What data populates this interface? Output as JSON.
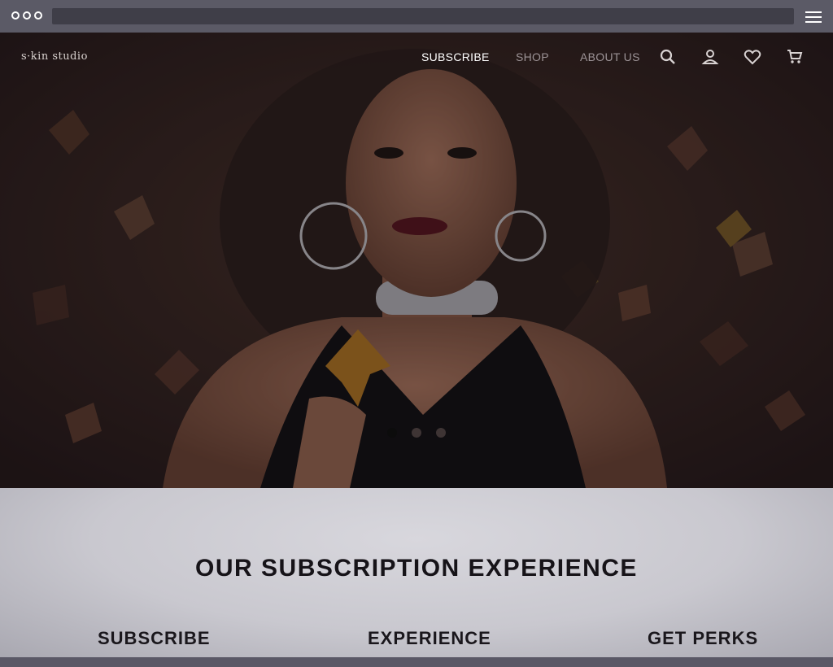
{
  "browser": {
    "window_controls": [
      "circle-icon",
      "circle-icon",
      "circle-icon"
    ],
    "menu_icon": "hamburger-icon"
  },
  "header": {
    "logo": "s·kin studio",
    "nav": [
      {
        "label": "SUBSCRIBE",
        "active": true
      },
      {
        "label": "SHOP",
        "active": false
      },
      {
        "label": "ABOUT US",
        "active": false
      }
    ],
    "icons": [
      "search-icon",
      "account-icon",
      "heart-icon",
      "cart-icon"
    ]
  },
  "hero": {
    "carousel": {
      "total": 3,
      "active_index": 0
    }
  },
  "section": {
    "title": "OUR SUBSCRIPTION EXPERIENCE",
    "columns": [
      {
        "title": "SUBSCRIBE"
      },
      {
        "title": "EXPERIENCE"
      },
      {
        "title": "GET PERKS"
      }
    ]
  },
  "colors": {
    "chrome": "#5b5a66",
    "nav_active": "#ffffff",
    "nav_inactive": "#9c9396",
    "section_bg": "#d8d7dd"
  }
}
